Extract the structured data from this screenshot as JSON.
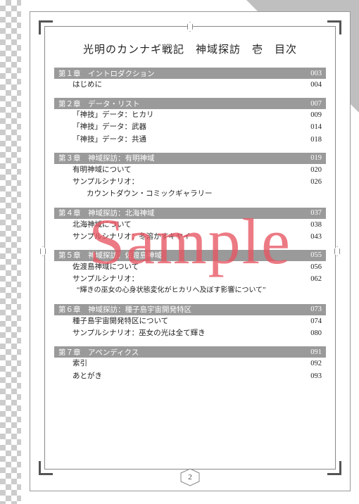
{
  "title": "光明のカンナギ戦記　神域探訪　壱　目次",
  "page_number": "2",
  "watermark": "Sample",
  "sections": [
    {
      "bar": {
        "label": "第１章　イントロダクション",
        "page": "003"
      },
      "rows": [
        {
          "label": "はじめに",
          "page": "004"
        }
      ]
    },
    {
      "bar": {
        "label": "第２章　データ・リスト",
        "page": "007"
      },
      "rows": [
        {
          "label": "「神技」データ：ヒカリ",
          "page": "009"
        },
        {
          "label": "「神技」データ：武器",
          "page": "014"
        },
        {
          "label": "「神技」データ：共通",
          "page": "018"
        }
      ]
    },
    {
      "bar": {
        "label": "第３章　神域探訪：有明神域",
        "page": "019"
      },
      "rows": [
        {
          "label": "有明神域について",
          "page": "020"
        },
        {
          "label": "サンプルシナリオ：",
          "page": "026"
        },
        {
          "label": "カウントダウン・コミックギャラリー",
          "page": "",
          "sub": true
        }
      ]
    },
    {
      "bar": {
        "label": "第４章　神域探訪：北海神域",
        "page": "037"
      },
      "rows": [
        {
          "label": "北海神域について",
          "page": "038"
        },
        {
          "label": "サンプルシナリオ：冬溶かすキヤイ",
          "page": "043"
        }
      ]
    },
    {
      "bar": {
        "label": "第５章　神域探訪：佐渡島神域",
        "page": "055"
      },
      "rows": [
        {
          "label": "佐渡島神域について",
          "page": "056"
        },
        {
          "label": "サンプルシナリオ：",
          "page": "062"
        },
        {
          "label": "“輝きの巫女の心身状態変化がヒカリへ及ぼす影響について”",
          "page": "",
          "quote": true
        }
      ]
    },
    {
      "bar": {
        "label": "第６章　神域探訪：種子島宇宙開発特区",
        "page": "073"
      },
      "rows": [
        {
          "label": "種子島宇宙開発特区について",
          "page": "074"
        },
        {
          "label": "サンプルシナリオ：巫女の光は全て輝き",
          "page": "080"
        }
      ]
    },
    {
      "bar": {
        "label": "第７章　アペンディクス",
        "page": "091"
      },
      "rows": [
        {
          "label": "索引",
          "page": "092"
        },
        {
          "label": "あとがき",
          "page": "093"
        }
      ]
    }
  ]
}
